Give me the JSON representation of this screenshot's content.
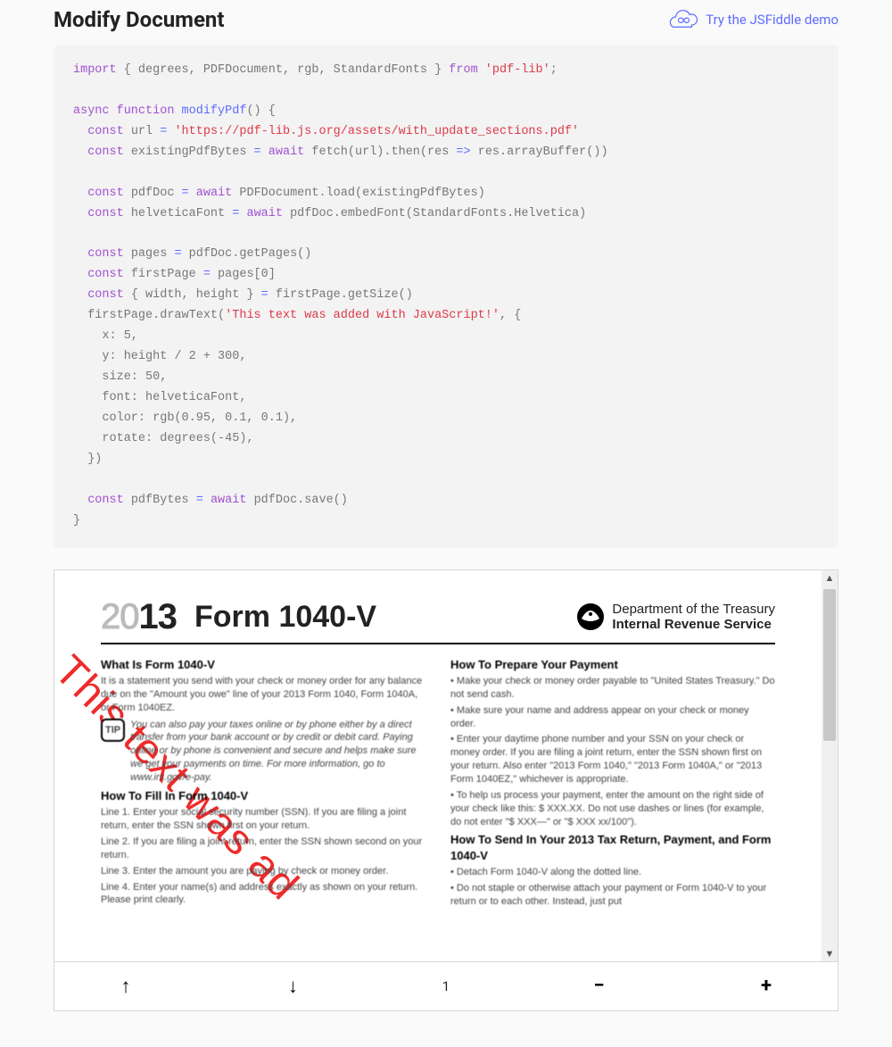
{
  "header": {
    "title": "Modify Document",
    "demo_link": "Try the JSFiddle demo"
  },
  "code": {
    "pkg": "'pdf-lib'",
    "fn": "modifyPdf",
    "url": "'https://pdf-lib.js.org/assets/with_update_sections.pdf'",
    "drawn_text": "'This text was added with JavaScript!'"
  },
  "viewer": {
    "scroll_up": "▲",
    "scroll_down": "▼",
    "page_number": "1",
    "prev": "↑",
    "next": "↓",
    "zoom_out": "−",
    "zoom_in": "+"
  },
  "doc": {
    "year_prefix": "20",
    "year_suffix": "13",
    "form_title": "Form 1040-V",
    "dept_line1": "Department of the Treasury",
    "dept_line2": "Internal Revenue Service",
    "overlay_text": "This text was ad",
    "left": {
      "h1": "What Is Form 1040-V",
      "p1": "It is a statement you send with your check or money order for any balance due on the \"Amount you owe\" line of your 2013 Form 1040, Form 1040A, or Form 1040EZ.",
      "tip_label": "TIP",
      "tip_text": "You can also pay your taxes online or by phone either by a direct transfer from your bank account or by credit or debit card. Paying online or by phone is convenient and secure and helps make sure we get your payments on time. For more information, go to www.irs.gov/e-pay.",
      "h2": "How To Fill In Form 1040-V",
      "l1": "Line 1. Enter your social security number (SSN). If you are filing a joint return, enter the SSN shown first on your return.",
      "l2": "Line 2. If you are filing a joint return, enter the SSN shown second on your return.",
      "l3": "Line 3. Enter the amount you are paying by check or money order.",
      "l4": "Line 4. Enter your name(s) and address exactly as shown on your return. Please print clearly."
    },
    "right": {
      "h1": "How To Prepare Your Payment",
      "b1": "• Make your check or money order payable to \"United States Treasury.\" Do not send cash.",
      "b2": "• Make sure your name and address appear on your check or money order.",
      "b3": "• Enter your daytime phone number and your SSN on your check or money order. If you are filing a joint return, enter the SSN shown first on your return. Also enter \"2013 Form 1040,\" \"2013 Form 1040A,\" or \"2013 Form 1040EZ,\" whichever is appropriate.",
      "b4": "• To help us process your payment, enter the amount on the right side of your check like this: $ XXX.XX. Do not use dashes or lines (for example, do not enter \"$ XXX—\" or \"$ XXX xx/100\").",
      "h2": "How To Send In Your 2013 Tax Return, Payment, and Form 1040-V",
      "b5": "• Detach Form 1040-V along the dotted line.",
      "b6": "• Do not staple or otherwise attach your payment or Form 1040-V to your return or to each other. Instead, just put"
    }
  }
}
